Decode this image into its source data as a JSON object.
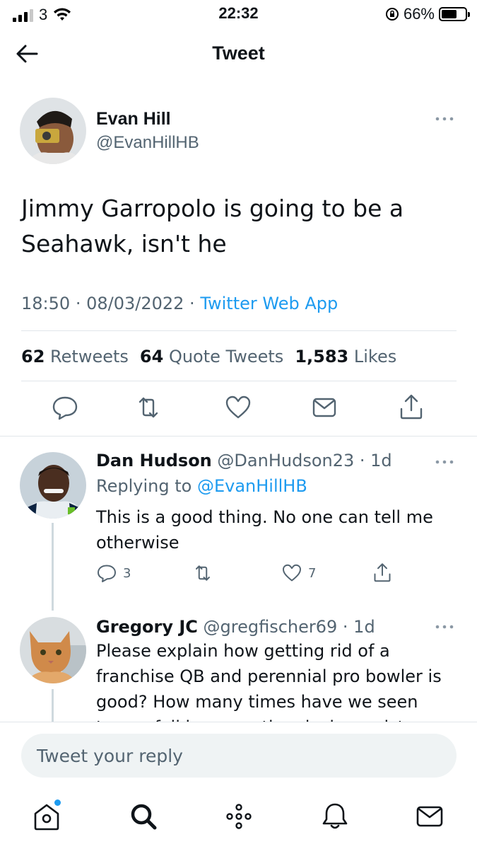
{
  "status_bar": {
    "carrier": "3",
    "time": "22:32",
    "battery_pct": "66%",
    "battery_level": 0.66
  },
  "header": {
    "title": "Tweet"
  },
  "tweet": {
    "author_name": "Evan Hill",
    "author_handle": "@EvanHillHB",
    "text": "Jimmy Garropolo is going to be a Seahawk, isn't he",
    "time": "18:50",
    "date": "08/03/2022",
    "source": "Twitter Web App",
    "retweets_count": "62",
    "retweets_label": "Retweets",
    "quotes_count": "64",
    "quotes_label": "Quote Tweets",
    "likes_count": "1,583",
    "likes_label": "Likes"
  },
  "replies": [
    {
      "name": "Dan Hudson",
      "handle": "@DanHudson23",
      "age": "1d",
      "replying_prefix": "Replying to",
      "replying_to": "@EvanHillHB",
      "text": "This is a good thing. No one can tell me otherwise",
      "reply_count": "3",
      "like_count": "7"
    },
    {
      "name": "Gregory JC",
      "handle": "@gregfischer69",
      "age": "1d",
      "text": "Please explain how getting rid of a franchise QB and perennial pro bowler is good? How many times have we seen teams fail because they lack consistency"
    }
  ],
  "composer": {
    "placeholder": "Tweet your reply"
  },
  "colors": {
    "accent": "#1d9bf0",
    "secondary_text": "#536471",
    "divider": "#e1e6ea"
  }
}
